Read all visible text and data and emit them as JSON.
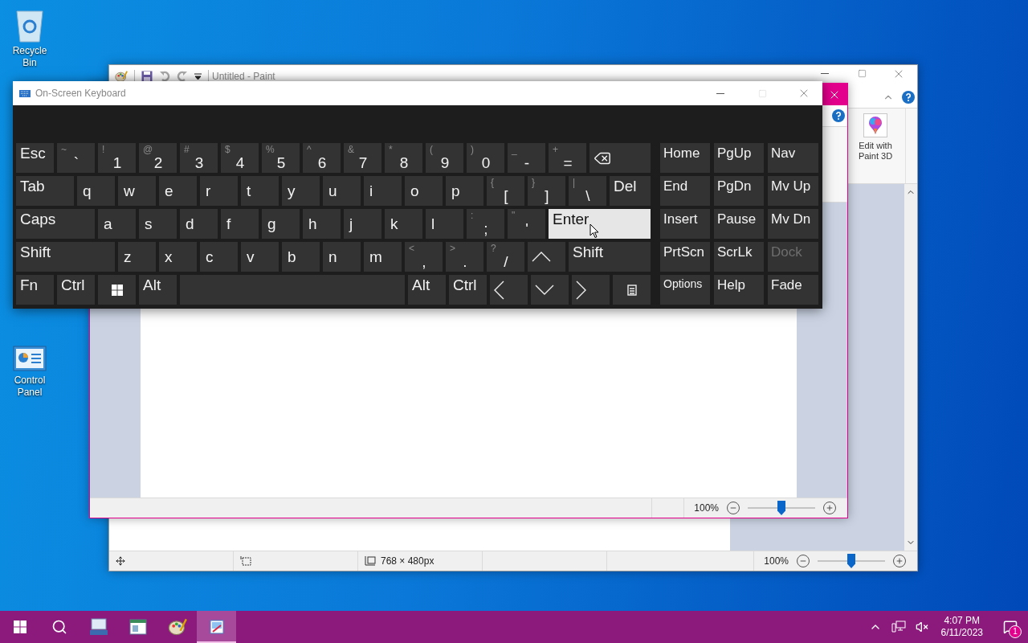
{
  "desktop": {
    "icons": [
      {
        "kind": "recycle",
        "label": "Recycle Bin"
      },
      {
        "kind": "control",
        "label": "Control Panel"
      }
    ]
  },
  "paint_back": {
    "title": "Untitled - Paint",
    "ribbon_button": "Edit with Paint 3D",
    "status": {
      "size": "768 × 480px",
      "zoom": "100%",
      "level": 0.5
    }
  },
  "paint_front": {
    "status": {
      "zoom": "100%",
      "level": 0.5
    }
  },
  "keyboard": {
    "title": "On-Screen Keyboard",
    "maximize_disabled": true,
    "main_rows": [
      [
        {
          "kind": "text",
          "label": "Esc",
          "highlighted": false
        },
        {
          "kind": "char",
          "shift": "~",
          "label": "`",
          "highlighted": false
        },
        {
          "kind": "char",
          "shift": "!",
          "label": "1",
          "highlighted": false
        },
        {
          "kind": "char",
          "shift": "@",
          "label": "2",
          "highlighted": false
        },
        {
          "kind": "char",
          "shift": "#",
          "label": "3",
          "highlighted": false
        },
        {
          "kind": "char",
          "shift": "$",
          "label": "4",
          "highlighted": false
        },
        {
          "kind": "char",
          "shift": "%",
          "label": "5",
          "highlighted": false
        },
        {
          "kind": "char",
          "shift": "^",
          "label": "6",
          "highlighted": false
        },
        {
          "kind": "char",
          "shift": "&",
          "label": "7",
          "highlighted": false
        },
        {
          "kind": "char",
          "shift": "*",
          "label": "8",
          "highlighted": false
        },
        {
          "kind": "char",
          "shift": "(",
          "label": "9",
          "highlighted": false
        },
        {
          "kind": "char",
          "shift": ")",
          "label": "0",
          "highlighted": false
        },
        {
          "kind": "char",
          "shift": "_",
          "label": "-",
          "highlighted": false
        },
        {
          "kind": "char",
          "shift": "+",
          "label": "=",
          "highlighted": false
        },
        {
          "kind": "backspace",
          "highlighted": false
        }
      ],
      [
        {
          "kind": "text",
          "label": "Tab",
          "highlighted": false
        },
        {
          "kind": "letter",
          "label": "q",
          "highlighted": false
        },
        {
          "kind": "letter",
          "label": "w",
          "highlighted": false
        },
        {
          "kind": "letter",
          "label": "e",
          "highlighted": false
        },
        {
          "kind": "letter",
          "label": "r",
          "highlighted": false
        },
        {
          "kind": "letter",
          "label": "t",
          "highlighted": false
        },
        {
          "kind": "letter",
          "label": "y",
          "highlighted": false
        },
        {
          "kind": "letter",
          "label": "u",
          "highlighted": false
        },
        {
          "kind": "letter",
          "label": "i",
          "highlighted": false
        },
        {
          "kind": "letter",
          "label": "o",
          "highlighted": false
        },
        {
          "kind": "letter",
          "label": "p",
          "highlighted": false
        },
        {
          "kind": "char",
          "shift": "{",
          "label": "[",
          "highlighted": false
        },
        {
          "kind": "char",
          "shift": "}",
          "label": "]",
          "highlighted": false
        },
        {
          "kind": "char",
          "shift": "|",
          "label": "\\",
          "highlighted": false
        },
        {
          "kind": "text",
          "label": "Del",
          "highlighted": false
        }
      ],
      [
        {
          "kind": "text",
          "label": "Caps",
          "highlighted": false
        },
        {
          "kind": "letter",
          "label": "a",
          "highlighted": false
        },
        {
          "kind": "letter",
          "label": "s",
          "highlighted": false
        },
        {
          "kind": "letter",
          "label": "d",
          "highlighted": false
        },
        {
          "kind": "letter",
          "label": "f",
          "highlighted": false
        },
        {
          "kind": "letter",
          "label": "g",
          "highlighted": false
        },
        {
          "kind": "letter",
          "label": "h",
          "highlighted": false
        },
        {
          "kind": "letter",
          "label": "j",
          "highlighted": false
        },
        {
          "kind": "letter",
          "label": "k",
          "highlighted": false
        },
        {
          "kind": "letter",
          "label": "l",
          "highlighted": false
        },
        {
          "kind": "char",
          "shift": ":",
          "label": ";",
          "highlighted": false
        },
        {
          "kind": "char",
          "shift": "\"",
          "label": "'",
          "highlighted": false
        },
        {
          "kind": "text",
          "label": "Enter",
          "highlighted": true
        }
      ],
      [
        {
          "kind": "text",
          "label": "Shift",
          "highlighted": false
        },
        {
          "kind": "letter",
          "label": "z",
          "highlighted": false
        },
        {
          "kind": "letter",
          "label": "x",
          "highlighted": false
        },
        {
          "kind": "letter",
          "label": "c",
          "highlighted": false
        },
        {
          "kind": "letter",
          "label": "v",
          "highlighted": false
        },
        {
          "kind": "letter",
          "label": "b",
          "highlighted": false
        },
        {
          "kind": "letter",
          "label": "n",
          "highlighted": false
        },
        {
          "kind": "letter",
          "label": "m",
          "highlighted": false
        },
        {
          "kind": "char",
          "shift": "<",
          "label": ",",
          "highlighted": false
        },
        {
          "kind": "char",
          "shift": ">",
          "label": ".",
          "highlighted": false
        },
        {
          "kind": "char",
          "shift": "?",
          "label": "/",
          "highlighted": false
        },
        {
          "kind": "up",
          "highlighted": false
        },
        {
          "kind": "text",
          "label": "Shift",
          "highlighted": false
        }
      ],
      [
        {
          "kind": "text",
          "label": "Fn",
          "highlighted": false
        },
        {
          "kind": "text",
          "label": "Ctrl",
          "highlighted": false
        },
        {
          "kind": "windows",
          "highlighted": false
        },
        {
          "kind": "text",
          "label": "Alt",
          "highlighted": false
        },
        {
          "kind": "space",
          "highlighted": false
        },
        {
          "kind": "text",
          "label": "Alt",
          "highlighted": false
        },
        {
          "kind": "text",
          "label": "Ctrl",
          "highlighted": false
        },
        {
          "kind": "left",
          "highlighted": false
        },
        {
          "kind": "down",
          "highlighted": false
        },
        {
          "kind": "right",
          "highlighted": false
        },
        {
          "kind": "menu",
          "highlighted": false
        }
      ]
    ],
    "side_rows": [
      [
        {
          "kind": "text",
          "label": "Home",
          "disabled": false
        },
        {
          "kind": "text",
          "label": "PgUp",
          "disabled": false
        },
        {
          "kind": "text",
          "label": "Nav",
          "disabled": false
        }
      ],
      [
        {
          "kind": "text",
          "label": "End",
          "disabled": false
        },
        {
          "kind": "text",
          "label": "PgDn",
          "disabled": false
        },
        {
          "kind": "text",
          "label": "Mv Up",
          "disabled": false
        }
      ],
      [
        {
          "kind": "text",
          "label": "Insert",
          "disabled": false
        },
        {
          "kind": "text",
          "label": "Pause",
          "disabled": false
        },
        {
          "kind": "text",
          "label": "Mv Dn",
          "disabled": false
        }
      ],
      [
        {
          "kind": "text",
          "label": "PrtScn",
          "disabled": false
        },
        {
          "kind": "text",
          "label": "ScrLk",
          "disabled": false
        },
        {
          "kind": "text",
          "label": "Dock",
          "disabled": true
        }
      ],
      [
        {
          "kind": "small",
          "label": "Options",
          "disabled": false
        },
        {
          "kind": "text",
          "label": "Help",
          "disabled": false
        },
        {
          "kind": "text",
          "label": "Fade",
          "disabled": false
        }
      ]
    ]
  },
  "taskbar": {
    "apps": [
      {
        "kind": "keyboard",
        "selected": false
      },
      {
        "kind": "window",
        "selected": false
      },
      {
        "kind": "palette",
        "selected": false
      },
      {
        "kind": "paint",
        "selected": true
      }
    ],
    "time": "4:07 PM",
    "date": "6/11/2023",
    "notifications": "1"
  }
}
